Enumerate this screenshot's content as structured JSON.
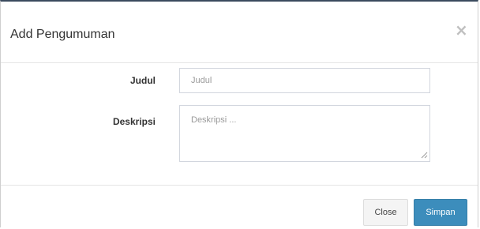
{
  "modal": {
    "title": "Add Pengumuman",
    "close_icon": "close-icon"
  },
  "form": {
    "judul": {
      "label": "Judul",
      "placeholder": "Judul",
      "value": ""
    },
    "deskripsi": {
      "label": "Deskripsi",
      "placeholder": "Deskripsi ...",
      "value": ""
    }
  },
  "footer": {
    "close_label": "Close",
    "save_label": "Simpan"
  },
  "colors": {
    "primary": "#3c8dbc",
    "default_button": "#f4f4f4",
    "header_accent": "#3a4a5e"
  }
}
